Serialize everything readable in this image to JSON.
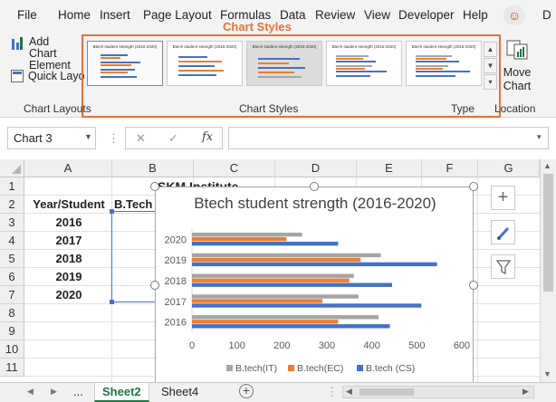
{
  "ribbon_tabs": [
    "File",
    "Home",
    "Insert",
    "Page Layout",
    "Formulas",
    "Data",
    "Review",
    "View",
    "Developer",
    "Help",
    "D"
  ],
  "ribbon": {
    "add_chart_element": "Add Chart Element",
    "quick_layout": "Quick Layo",
    "chart_styles_callout": "Chart Styles",
    "group_chart_layouts": "Chart Layouts",
    "group_chart_styles": "Chart Styles",
    "group_type": "Type",
    "group_location": "Location",
    "move_chart": "Move Chart",
    "thumb_titles": [
      "Btech student strength (2016-2020)",
      "Btech student strength (2016-2020)",
      "Btech student strength (2016-2020)",
      "Btech student strength (2016-2020)",
      "Btech student strength (2016-2020)"
    ],
    "colors": {
      "accent": "#e8703a",
      "excel_green": "#217346"
    }
  },
  "formula_bar": {
    "name_box": "Chart 3",
    "cancel": "✕",
    "enter": "✓",
    "fx": "fx",
    "value": ""
  },
  "grid": {
    "columns": [
      "A",
      "B",
      "C",
      "D",
      "E",
      "F",
      "G"
    ],
    "rows": [
      "1",
      "2",
      "3",
      "4",
      "5",
      "6",
      "7",
      "8",
      "9",
      "10",
      "11"
    ],
    "c1": "SKM Institute",
    "a2": "Year/Student",
    "b2": "B.Tech",
    "years": [
      "2016",
      "2017",
      "2018",
      "2019",
      "2020"
    ]
  },
  "chart_data": {
    "type": "bar",
    "orientation": "horizontal",
    "title": "Btech student strength (2016-2020)",
    "categories": [
      "2016",
      "2017",
      "2018",
      "2019",
      "2020"
    ],
    "series": [
      {
        "name": "B.tech(IT)",
        "color": "#a5a5a5",
        "values": [
          415,
          370,
          360,
          420,
          245
        ]
      },
      {
        "name": "B.tech(EC)",
        "color": "#ed7d31",
        "values": [
          325,
          290,
          350,
          375,
          210
        ]
      },
      {
        "name": "B.tech (CS)",
        "color": "#4472c4",
        "values": [
          440,
          510,
          445,
          545,
          325
        ]
      }
    ],
    "xlim": [
      0,
      600
    ],
    "xticks": [
      "0",
      "100",
      "200",
      "300",
      "400",
      "500",
      "600"
    ],
    "legend": "bottom",
    "gridlines": false
  },
  "sheets": {
    "nav_prev": "◀",
    "nav_next": "▶",
    "ellipsis": "...",
    "tabs": [
      "Sheet2",
      "Sheet4"
    ],
    "active": "Sheet2",
    "add": "+"
  }
}
